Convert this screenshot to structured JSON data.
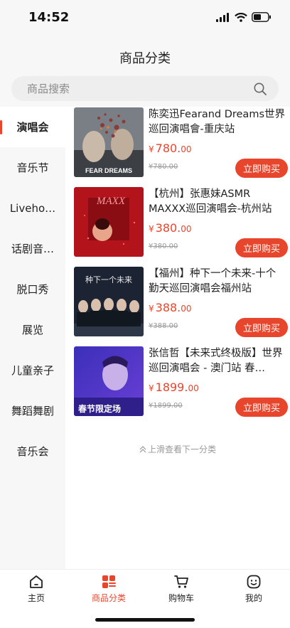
{
  "status": {
    "time": "14:52"
  },
  "header": {
    "title": "商品分类"
  },
  "search": {
    "placeholder": "商品搜索"
  },
  "sidebar": {
    "items": [
      {
        "label": "演唱会",
        "active": true
      },
      {
        "label": "音乐节"
      },
      {
        "label": "Liveho…"
      },
      {
        "label": "话剧音…"
      },
      {
        "label": "脱口秀"
      },
      {
        "label": "展览"
      },
      {
        "label": "儿童亲子"
      },
      {
        "label": "舞蹈舞剧"
      },
      {
        "label": "音乐会"
      }
    ]
  },
  "products": [
    {
      "title": "陈奕迅Fearand Dreams世界巡回演唱會-重庆站",
      "currency": "¥",
      "price_int": "780.",
      "price_dec": "00",
      "old_price": "¥780.00",
      "buy_label": "立即购买",
      "poster_text": "FEAR DREAMS"
    },
    {
      "title": "【杭州】张惠妹ASMR MAXXX巡回演唱会-杭州站",
      "currency": "¥",
      "price_int": "380.",
      "price_dec": "00",
      "old_price": "¥380.00",
      "buy_label": "立即购买",
      "poster_text": "MAXX"
    },
    {
      "title": "【福州】种下一个未来-十个勤天巡回演唱会福州站",
      "currency": "¥",
      "price_int": "388.",
      "price_dec": "00",
      "old_price": "¥388.00",
      "buy_label": "立即购买",
      "poster_text": "种下一个未来"
    },
    {
      "title": "张信哲【未来式终极版】世界巡回演唱会 - 澳门站 春…",
      "currency": "¥",
      "price_int": "1899.",
      "price_dec": "00",
      "old_price": "¥1899.00",
      "buy_label": "立即购买",
      "poster_text": "春节限定场"
    }
  ],
  "footer_hint": "上滑查看下一分类",
  "tabbar": {
    "items": [
      {
        "label": "主页",
        "icon": "home-icon"
      },
      {
        "label": "商品分类",
        "icon": "category-icon",
        "active": true
      },
      {
        "label": "购物车",
        "icon": "cart-icon"
      },
      {
        "label": "我的",
        "icon": "profile-icon"
      }
    ]
  },
  "colors": {
    "accent": "#e8462c",
    "background": "#f7f7f7"
  }
}
